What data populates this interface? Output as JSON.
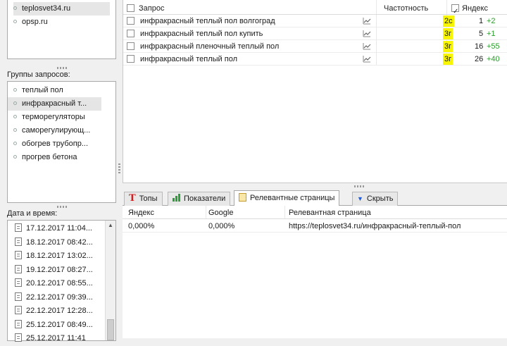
{
  "sites": [
    {
      "label": "teplosvet34.ru",
      "selected": true
    },
    {
      "label": "opsp.ru",
      "selected": false
    }
  ],
  "groups_label": "Группы запросов:",
  "groups": [
    {
      "label": "теплый пол",
      "selected": false
    },
    {
      "label": "инфракрасный т...",
      "selected": true
    },
    {
      "label": "терморегуляторы",
      "selected": false
    },
    {
      "label": "саморегулирующ...",
      "selected": false
    },
    {
      "label": "обогрев трубопр...",
      "selected": false
    },
    {
      "label": "прогрев бетона",
      "selected": false
    }
  ],
  "dates_label": "Дата и время:",
  "dates": [
    "17.12.2017 11:04...",
    "18.12.2017 08:42...",
    "18.12.2017 13:02...",
    "19.12.2017 08:27...",
    "20.12.2017 08:55...",
    "22.12.2017 09:39...",
    "22.12.2017 12:28...",
    "25.12.2017 08:49...",
    "25.12.2017 11:41"
  ],
  "main_table": {
    "headers": {
      "query": "Запрос",
      "frequency": "Частотность",
      "yandex": "Яндекс"
    },
    "rows": [
      {
        "query": "инфракрасный теплый пол волгоград",
        "badge": "2с",
        "position": "1",
        "delta": "+2"
      },
      {
        "query": "инфракрасный теплый пол купить",
        "badge": "3г",
        "position": "5",
        "delta": "+1"
      },
      {
        "query": "инфракрасный пленочный теплый пол",
        "badge": "3г",
        "position": "16",
        "delta": "+55"
      },
      {
        "query": "инфракрасный теплый пол",
        "badge": "3г",
        "position": "26",
        "delta": "+40"
      }
    ]
  },
  "tabs": {
    "tops": "Топы",
    "metrics": "Показатели",
    "relevant": "Релевантные страницы",
    "hide": "Скрыть"
  },
  "bottom_table": {
    "headers": {
      "yandex": "Яндекс",
      "google": "Google",
      "page": "Релевантная страница"
    },
    "rows": [
      {
        "yandex": "0,000%",
        "google": "0,000%",
        "page": "https://teplosvet34.ru/инфракрасный-теплый-пол"
      }
    ]
  },
  "colors": {
    "badge": "#f7f500",
    "delta": "#2a9d2a",
    "tops_icon": "#d71c1c",
    "hide_icon": "#1f5fd6"
  }
}
